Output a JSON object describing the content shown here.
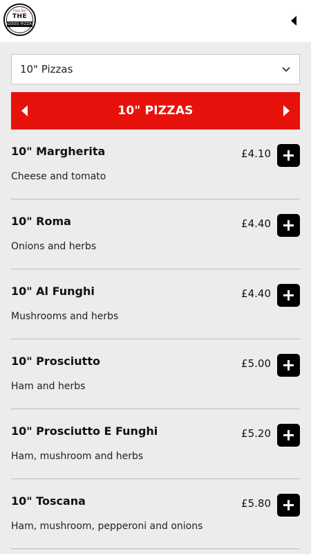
{
  "header": {
    "logo": {
      "top_text": "Pizza Bar",
      "main_text": "THE",
      "banner_text": "GOOD PIZZA"
    },
    "back_icon": "caret-left-icon"
  },
  "category_select": {
    "value": "10\" Pizzas",
    "icon": "chevron-down-icon"
  },
  "category_bar": {
    "title": "10\" PIZZAS",
    "prev_icon": "caret-left-icon",
    "next_icon": "caret-right-icon",
    "color": "#e8120c"
  },
  "items": [
    {
      "name": "10\" Margherita",
      "description": "Cheese and tomato",
      "price": "£4.10"
    },
    {
      "name": "10\" Roma",
      "description": "Onions and herbs",
      "price": "£4.40"
    },
    {
      "name": "10\" Al Funghi",
      "description": "Mushrooms and herbs",
      "price": "£4.40"
    },
    {
      "name": "10\" Prosciutto",
      "description": "Ham and herbs",
      "price": "£5.00"
    },
    {
      "name": "10\" Prosciutto E Funghi",
      "description": "Ham, mushroom and herbs",
      "price": "£5.20"
    },
    {
      "name": "10\" Toscana",
      "description": "Ham, mushroom, pepperoni and onions",
      "price": "£5.80"
    }
  ],
  "add_icon": "plus-icon"
}
